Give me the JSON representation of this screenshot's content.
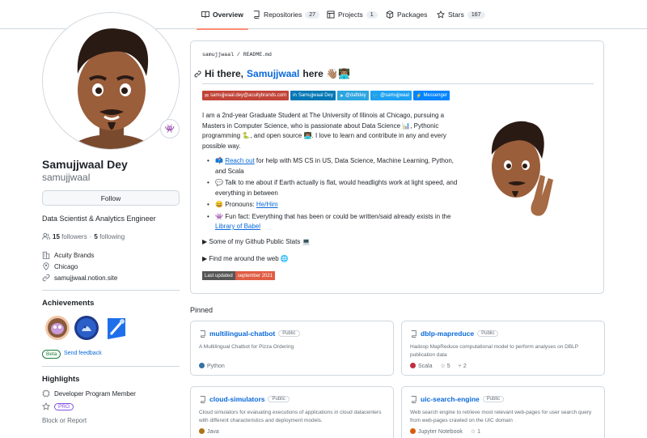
{
  "nav": {
    "tabs": [
      {
        "label": "Overview",
        "count": ""
      },
      {
        "label": "Repositories",
        "count": "27"
      },
      {
        "label": "Projects",
        "count": "1"
      },
      {
        "label": "Packages",
        "count": ""
      },
      {
        "label": "Stars",
        "count": "167"
      }
    ]
  },
  "profile": {
    "fullname": "Samujjwaal Dey",
    "login": "samujjwaal",
    "follow_label": "Follow",
    "bio": "Data Scientist & Analytics Engineer",
    "followers_count": "15",
    "followers_label": "followers",
    "separator": "·",
    "following_count": "5",
    "following_label": "following",
    "company": "Acuity Brands",
    "location": "Chicago",
    "website": "samujjwaal.notion.site"
  },
  "achievements": {
    "title": "Achievements",
    "beta_label": "Beta",
    "feedback_label": "Send feedback"
  },
  "highlights": {
    "title": "Highlights",
    "items": [
      "Developer Program Member"
    ],
    "pro_label": "PRO",
    "block_label": "Block or Report"
  },
  "readme": {
    "crumb_user": "samujjwaal",
    "crumb_sep": "/",
    "crumb_file": "README.md",
    "greeting_prefix": "Hi there,",
    "greeting_name": "Samujjwaal",
    "greeting_suffix": "here 👋🏽👨🏽‍💻",
    "shields": [
      {
        "label": "samujjwaal.dey@acuitybrands.com",
        "color": "#c14438"
      },
      {
        "label": "Samujjwaal Dey",
        "color": "#0077b5"
      },
      {
        "label": "@daftdey",
        "color": "#2ca5e0"
      },
      {
        "label": "@samujjwaal",
        "color": "#1da1f2"
      },
      {
        "label": "Messenger",
        "color": "#0084ff"
      }
    ],
    "intro": "I am a 2nd-year Graduate Student at The University of Illinois at Chicago, pursuing a Masters in Computer Science, who is passionate about Data Science 📊, Pythonic programming 🐍, and open source 👨🏽‍💻. I love to learn and contribute in any and every possible way.",
    "bullets": [
      {
        "emoji": "📫",
        "link": "Reach out",
        "text": " for help with MS CS in US, Data Science, Machine Learning, Python, and Scala"
      },
      {
        "emoji": "💬",
        "link": "",
        "text": " Talk to me about if Earth actually is flat, would headlights work at light speed, and everything in between"
      },
      {
        "emoji": "😄",
        "link": "",
        "text": " Pronouns: ",
        "link2": "He/Him"
      },
      {
        "emoji": "👾",
        "link": "",
        "text": " Fun fact: Everything that has been or could be written/said already exists in the ",
        "link2": "Library of Babel"
      }
    ],
    "details1": "▶ Some of my Github Public Stats 💻",
    "details2": "▶ Find me around the web 🌐",
    "updated_label": "Last updated",
    "updated_value": "september 2021",
    "updated_colors": {
      "left": "#555555",
      "right": "#e05d44"
    }
  },
  "pinned": {
    "title": "Pinned",
    "public_label": "Public",
    "repos": [
      {
        "name": "multilingual-chatbot",
        "desc": "A Multilingual Chatbot for Pizza Ordering",
        "lang": "Python",
        "lang_color": "#3572A5",
        "stars": "",
        "forks": ""
      },
      {
        "name": "dblp-mapreduce",
        "desc": "Hadoop MapReduce computational model to perform analyses on DBLP publication data",
        "lang": "Scala",
        "lang_color": "#c22d40",
        "stars": "5",
        "forks": "2"
      },
      {
        "name": "cloud-simulators",
        "desc": "Cloud simulators for evaluating executions of applications in cloud datacenters with different characteristics and deployment models.",
        "lang": "Java",
        "lang_color": "#b07219",
        "stars": "",
        "forks": ""
      },
      {
        "name": "uic-search-engine",
        "desc": "Web search engine to retrieve most relevant web-pages for user search query from web-pages crawled on the UIC domain",
        "lang": "Jupyter Notebook",
        "lang_color": "#DA5B0B",
        "stars": "1",
        "forks": ""
      }
    ]
  }
}
